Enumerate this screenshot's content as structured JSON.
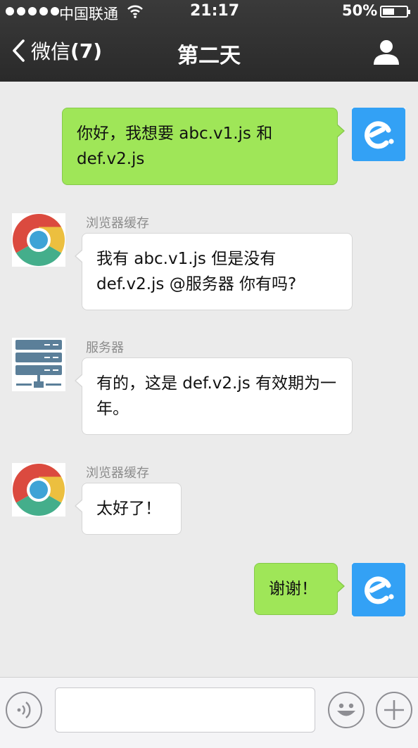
{
  "status_bar": {
    "carrier": "中国联通",
    "time": "21:17",
    "battery_percent": "50%",
    "battery_level": 0.5
  },
  "nav": {
    "back_label": "微信",
    "back_count": "(7)",
    "title": "第二天"
  },
  "messages": [
    {
      "direction": "out",
      "sender": "",
      "avatar": "app-logo-icon",
      "text": "你好，我想要 abc.v1.js 和 def.v2.js"
    },
    {
      "direction": "in",
      "sender": "浏览器缓存",
      "avatar": "chrome-icon",
      "text": "我有 abc.v1.js 但是没有 def.v2.js @服务器 你有吗?"
    },
    {
      "direction": "in",
      "sender": "服务器",
      "avatar": "server-icon",
      "text": "有的，这是 def.v2.js 有效期为一年。"
    },
    {
      "direction": "in",
      "sender": "浏览器缓存",
      "avatar": "chrome-icon",
      "text": "太好了！"
    },
    {
      "direction": "out",
      "sender": "",
      "avatar": "app-logo-icon",
      "text": "谢谢！"
    }
  ],
  "input_bar": {
    "value": "",
    "placeholder": ""
  },
  "colors": {
    "nav_bg": "#2e2e2e",
    "chat_bg": "#ebebeb",
    "outgoing_bubble": "#9fe658",
    "incoming_bubble": "#ffffff",
    "app_logo_bg": "#33a1f5"
  }
}
